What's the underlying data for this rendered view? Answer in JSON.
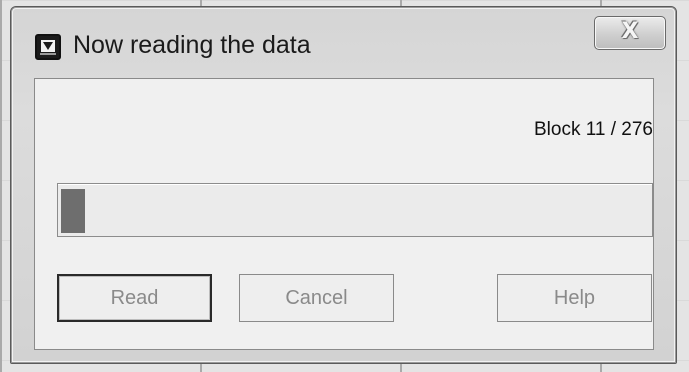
{
  "window": {
    "title": "Now reading the data",
    "close_label": "X"
  },
  "status": {
    "block_text": "Block 11 / 276",
    "current_block": 11,
    "total_blocks": 276,
    "progress_fraction": 0.04
  },
  "buttons": {
    "read": "Read",
    "cancel": "Cancel",
    "help": "Help"
  },
  "icons": {
    "title": "app-icon",
    "close": "close-icon"
  }
}
